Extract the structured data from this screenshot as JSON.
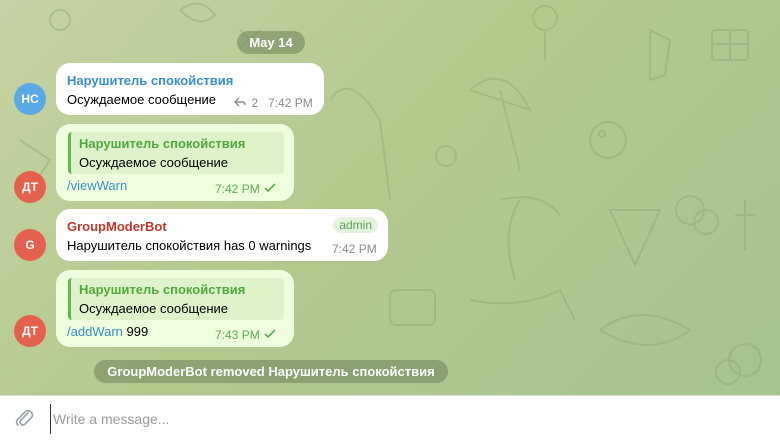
{
  "chat": {
    "date": "May 14",
    "messages": [
      {
        "avatar": {
          "initials": "НС",
          "color": "#5aa8e6"
        },
        "sender": "Нарушитель спокойствия",
        "sender_color": "#3a8fc8",
        "text": "Осуждаемое сообщение",
        "reply_count": "2",
        "time": "7:42 PM"
      },
      {
        "avatar": {
          "initials": "ДТ",
          "color": "#e4614f"
        },
        "outgoing": true,
        "reply_to": {
          "sender": "Нарушитель спокойствия",
          "text": "Осуждаемое сообщение"
        },
        "command": "/viewWarn",
        "args": "",
        "time": "7:42 PM",
        "status": "read"
      },
      {
        "avatar": {
          "initials": "G",
          "color": "#e4614f"
        },
        "sender": "GroupModerBot",
        "sender_color": "#c0392b",
        "badge": "admin",
        "text": "Нарушитель спокойствия has 0 warnings",
        "time": "7:42 PM"
      },
      {
        "avatar": {
          "initials": "ДТ",
          "color": "#e4614f"
        },
        "outgoing": true,
        "reply_to": {
          "sender": "Нарушитель спокойствия",
          "text": "Осуждаемое сообщение"
        },
        "command": "/addWarn",
        "args": " 999",
        "time": "7:43 PM",
        "status": "read"
      }
    ],
    "service_message": "GroupModerBot removed Нарушитель спокойствия"
  },
  "composer": {
    "placeholder": "Write a message...",
    "value": "",
    "attach_icon": "paperclip-icon"
  },
  "colors": {
    "incoming_bubble": "#ffffff",
    "outgoing_bubble": "#effedd",
    "accent_green": "#5cb94a",
    "link_blue": "#3a8fc8"
  }
}
